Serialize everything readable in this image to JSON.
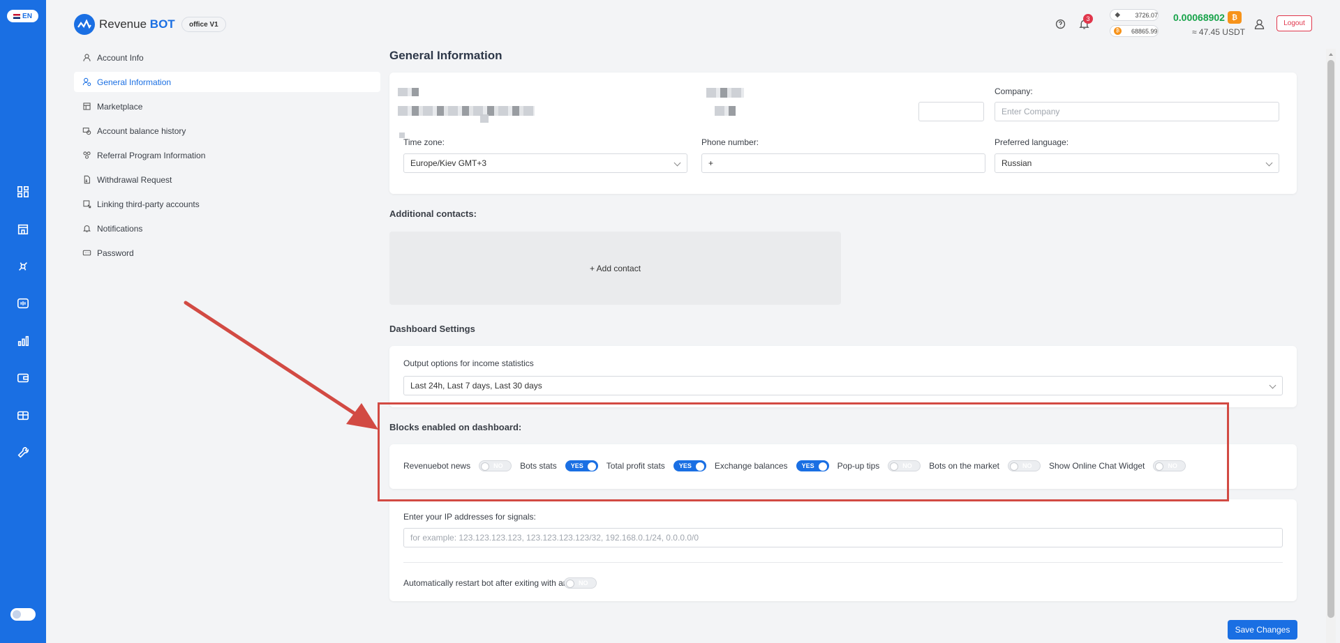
{
  "header": {
    "lang": "EN",
    "logo_text_plain": "Revenue",
    "logo_text_bold": "BOT",
    "office_badge": "office V1",
    "notifications_count": "3",
    "eth_price": "3726.07",
    "btc_price": "68865.99",
    "balance": "0.00068902",
    "balance_usdt": "≈ 47.45 USDT",
    "logout_label": "Logout"
  },
  "settings_nav": {
    "items": [
      {
        "label": "Account Info",
        "icon": "user-icon"
      },
      {
        "label": "General Information",
        "icon": "user-settings-icon"
      },
      {
        "label": "Marketplace",
        "icon": "marketplace-icon"
      },
      {
        "label": "Account balance history",
        "icon": "balance-history-icon"
      },
      {
        "label": "Referral Program Information",
        "icon": "referral-icon"
      },
      {
        "label": "Withdrawal Request",
        "icon": "withdrawal-icon"
      },
      {
        "label": "Linking third-party accounts",
        "icon": "link-icon"
      },
      {
        "label": "Notifications",
        "icon": "bell-icon"
      },
      {
        "label": "Password",
        "icon": "password-icon"
      }
    ]
  },
  "main": {
    "page_title": "General Information",
    "company_label": "Company:",
    "company_placeholder": "Enter Company",
    "timezone_label": "Time zone:",
    "timezone_value": "Europe/Kiev GMT+3",
    "phone_label": "Phone number:",
    "phone_value": "+",
    "language_label": "Preferred language:",
    "language_value": "Russian",
    "additional_contacts_title": "Additional contacts:",
    "add_contact_label": "+ Add contact",
    "dashboard_settings_title": "Dashboard Settings",
    "income_stats_label": "Output options for income statistics",
    "income_stats_value": "Last 24h, Last 7 days, Last 30 days",
    "blocks_title": "Blocks enabled on dashboard:",
    "blocks": [
      {
        "label": "Revenuebot news",
        "state": "NO"
      },
      {
        "label": "Bots stats",
        "state": "YES"
      },
      {
        "label": "Total profit stats",
        "state": "YES"
      },
      {
        "label": "Exchange balances",
        "state": "YES"
      },
      {
        "label": "Pop-up tips",
        "state": "NO"
      },
      {
        "label": "Bots on the market",
        "state": "NO"
      },
      {
        "label": "Show Online Chat Widget",
        "state": "NO"
      }
    ],
    "ip_label": "Enter your IP addresses for signals:",
    "ip_placeholder": "for example: 123.123.123.123, 123.123.123.123/32, 192.168.0.1/24, 0.0.0.0/0",
    "auto_restart_label": "Automatically restart bot after exiting with an error",
    "auto_restart_state": "NO",
    "save_label": "Save Changes"
  },
  "colors": {
    "brand": "#1a6fe3",
    "annotation": "#d24a43",
    "balance_green": "#17a34a",
    "danger": "#e0364b"
  }
}
